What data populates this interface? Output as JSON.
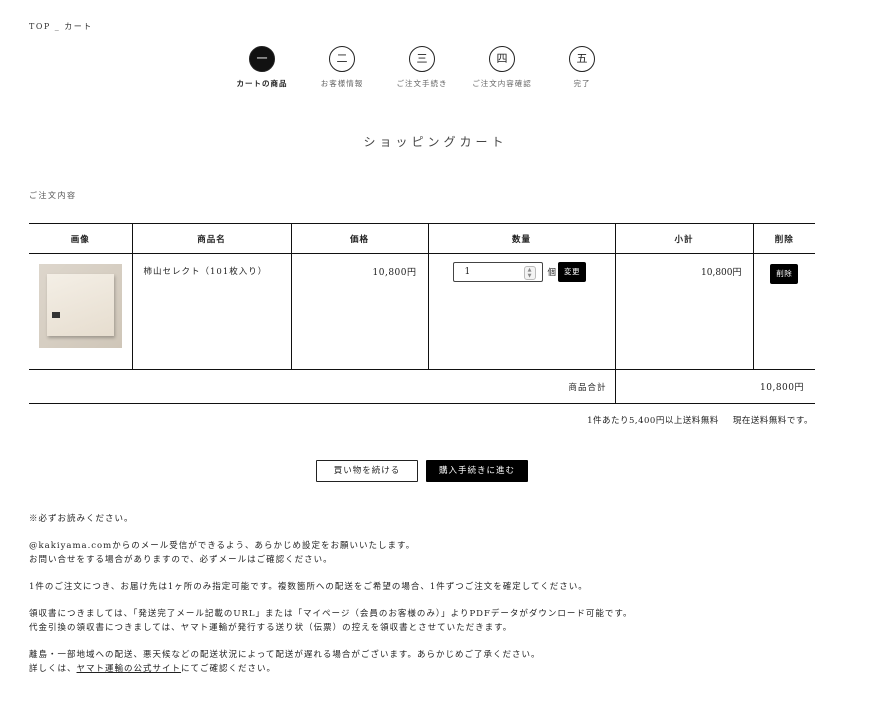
{
  "breadcrumb": {
    "home": "TOP",
    "separator": "_",
    "current": "カート"
  },
  "steps": [
    {
      "num": "一",
      "label": "カートの商品"
    },
    {
      "num": "二",
      "label": "お客様情報"
    },
    {
      "num": "三",
      "label": "ご注文手続き"
    },
    {
      "num": "四",
      "label": "ご注文内容確認"
    },
    {
      "num": "五",
      "label": "完了"
    }
  ],
  "page_title": "ショッピングカート",
  "section_label": "ご注文内容",
  "table": {
    "headers": [
      "画像",
      "商品名",
      "価格",
      "数量",
      "小計",
      "削除"
    ],
    "items": [
      {
        "name": "柿山セレクト（101枚入り）",
        "price": "10,800円",
        "quantity": "1",
        "unit": "個",
        "change_label": "変更",
        "subtotal": "10,800円",
        "delete_label": "削除"
      }
    ],
    "total_label": "商品合計",
    "total_value": "10,800円"
  },
  "shipping": {
    "threshold": "1件あたり5,400円以上送料無料",
    "status": "現在送料無料です。"
  },
  "buttons": {
    "continue": "買い物を続ける",
    "proceed": "購入手続きに進む"
  },
  "notes": {
    "line1": "※必ずお読みください。",
    "line2": "@kakiyama.comからのメール受信ができるよう、あらかじめ設定をお願いいたします。",
    "line3": "お問い合せをする場合がありますので、必ずメールはご確認ください。",
    "line4": "1件のご注文につき、お届け先は1ヶ所のみ指定可能です。複数箇所への配送をご希望の場合、1件ずつご注文を確定してください。",
    "line5": "領収書につきましては、「発送完了メール記載のURL」または「マイページ（会員のお客様のみ）」よりPDFデータがダウンロード可能です。",
    "line6": "代金引換の領収書につきましては、ヤマト運輸が発行する送り状（伝票）の控えを領収書とさせていただきます。",
    "line7": "離島・一部地域への配送、悪天候などの配送状況によって配送が遅れる場合がございます。あらかじめご了承ください。",
    "line8_pre": "詳しくは、",
    "line8_link": "ヤマト運輸の公式サイト",
    "line8_post": "にてご確認ください。"
  }
}
